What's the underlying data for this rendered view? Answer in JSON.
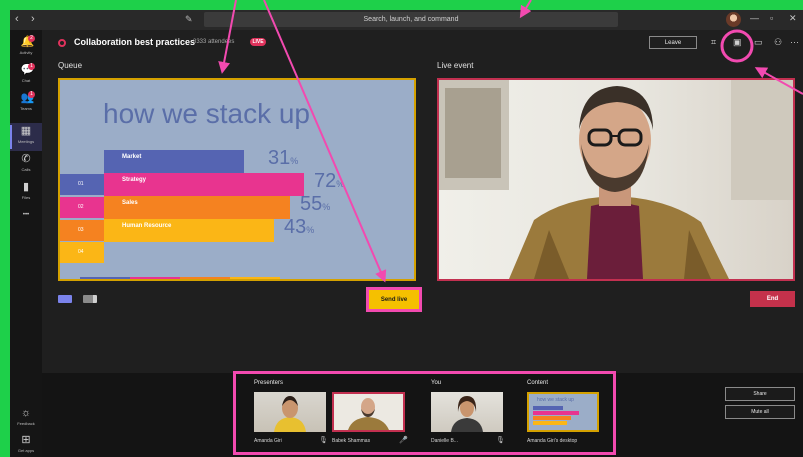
{
  "app": {
    "search_placeholder": "Search, launch, and command",
    "nav_back": "‹",
    "nav_forward": "›"
  },
  "rail": {
    "items": [
      {
        "label": "Activity",
        "icon": "bell-icon",
        "glyph": "🔔",
        "badge": "2"
      },
      {
        "label": "Chat",
        "icon": "chat-icon",
        "glyph": "💬",
        "badge": "1"
      },
      {
        "label": "Teams",
        "icon": "teams-icon",
        "glyph": "👥",
        "badge": "1"
      },
      {
        "label": "Meetings",
        "icon": "calendar-icon",
        "glyph": "▦",
        "badge": ""
      },
      {
        "label": "Calls",
        "icon": "phone-icon",
        "glyph": "✆",
        "badge": ""
      },
      {
        "label": "Files",
        "icon": "file-icon",
        "glyph": "▮",
        "badge": ""
      },
      {
        "label": "",
        "icon": "more-icon",
        "glyph": "•••",
        "badge": ""
      }
    ],
    "bottom": [
      {
        "label": "Feedback",
        "icon": "lightbulb-icon",
        "glyph": "☼"
      },
      {
        "label": "Get apps",
        "icon": "apps-icon",
        "glyph": "⊞"
      }
    ]
  },
  "meeting": {
    "title": "Collaboration best practices",
    "attendees": "3333 attendees",
    "live_badge": "LIVE",
    "leave_label": "Leave"
  },
  "queue": {
    "label": "Queue",
    "slide": {
      "title": "how we stack up",
      "rows": [
        {
          "num": "01",
          "title": "Market",
          "percent": "31",
          "color": "#5564b2"
        },
        {
          "num": "02",
          "title": "Strategy",
          "percent": "72",
          "color": "#e8348f"
        },
        {
          "num": "03",
          "title": "Sales",
          "percent": "55",
          "color": "#f58220"
        },
        {
          "num": "04",
          "title": "Human Resource",
          "percent": "43",
          "color": "#fbb616"
        }
      ],
      "pct_sign": "%"
    },
    "send_live_label": "Send live"
  },
  "live_event": {
    "label": "Live event",
    "end_label": "End"
  },
  "bottom": {
    "presenters_label": "Presenters",
    "you_label": "You",
    "content_label": "Content",
    "presenters": [
      {
        "name": "Amanda Giri"
      },
      {
        "name": "Babek Shammas"
      }
    ],
    "you": {
      "name": "Danielle B..."
    },
    "content": {
      "name": "Amanda Giri's desktop",
      "thumb_title": "how we stack up"
    },
    "share_label": "Share",
    "mute_all_label": "Mute all"
  },
  "colors": {
    "accent": "#7b83eb",
    "live_red": "#e0325c",
    "send_yellow": "#f5c000",
    "annotation_pink": "#f24ab0",
    "frame_gold": "#d4a100"
  }
}
